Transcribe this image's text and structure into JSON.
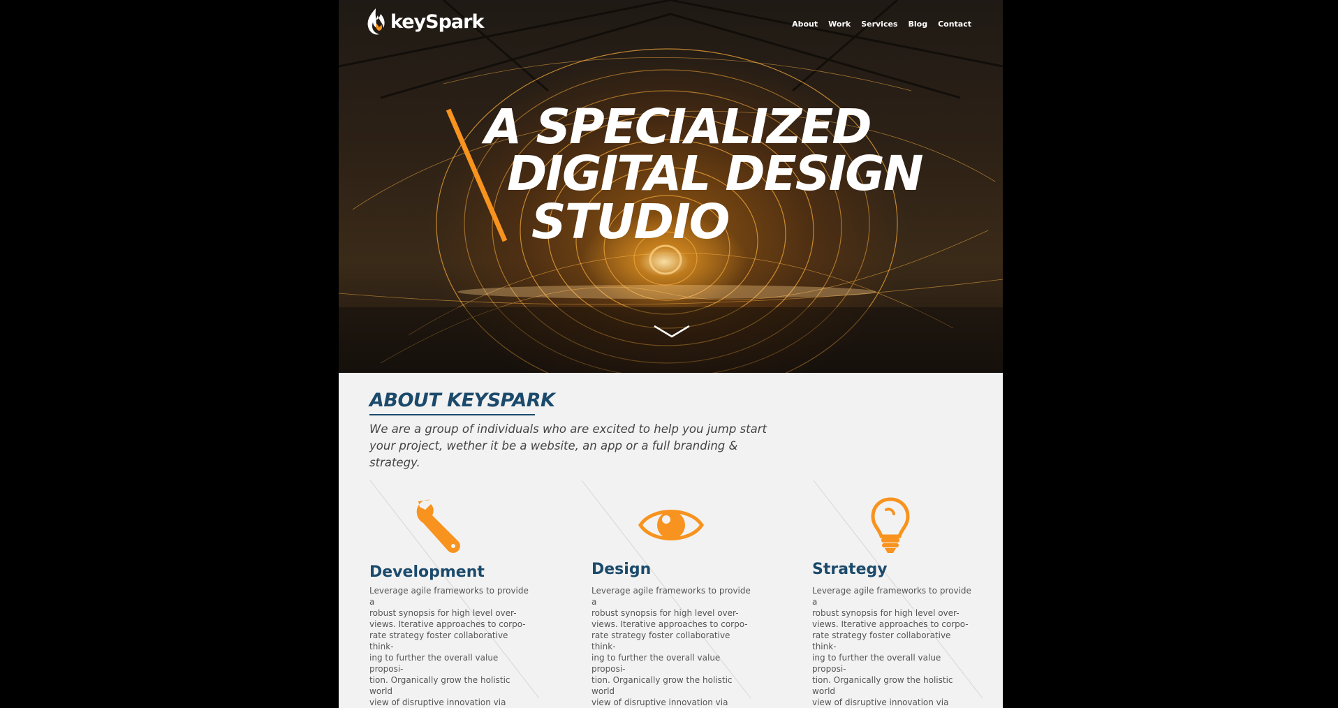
{
  "brand": {
    "name": "keySpark",
    "accent_color": "#f7931e",
    "heading_color": "#1b4a6b"
  },
  "nav": {
    "items": [
      "About",
      "Work",
      "Services",
      "Blog",
      "Contact"
    ]
  },
  "hero": {
    "title_lines": [
      "A SPECIALIZED",
      "DIGITAL DESIGN",
      "STUDIO"
    ],
    "scroll_icon": "chevron-down-icon"
  },
  "about": {
    "title": "ABOUT KEYSPARK",
    "text": "We are a group of individuals who are excited to help you jump start your project, wether it be a website, an app or a full branding & strategy."
  },
  "services": [
    {
      "icon": "wrench-icon",
      "title": "Development",
      "text": "Leverage agile frameworks to provide a\nrobust synopsis for high level over-\nviews. Iterative approaches to corpo-\nrate strategy foster collaborative think-\ning to further the overall value proposi-\ntion. Organically grow the holistic world\nview of disruptive innovation via work-\nplace diversity and empowerment."
    },
    {
      "icon": "eye-icon",
      "title": "Design",
      "text": "Leverage agile frameworks to provide a\nrobust synopsis for high level over-\nviews. Iterative approaches to corpo-\nrate strategy foster collaborative think-\ning to further the overall value proposi-\ntion. Organically grow the holistic world\nview of disruptive innovation via work-\nplace diversity and empowerment."
    },
    {
      "icon": "lightbulb-icon",
      "title": "Strategy",
      "text": "Leverage agile frameworks to provide a\nrobust synopsis for high level over-\nviews. Iterative approaches to corpo-\nrate strategy foster collaborative think-\ning to further the overall value proposi-\ntion. Organically grow the holistic world\nview of disruptive innovation via work-\nplace diversity and empowerment."
    }
  ]
}
